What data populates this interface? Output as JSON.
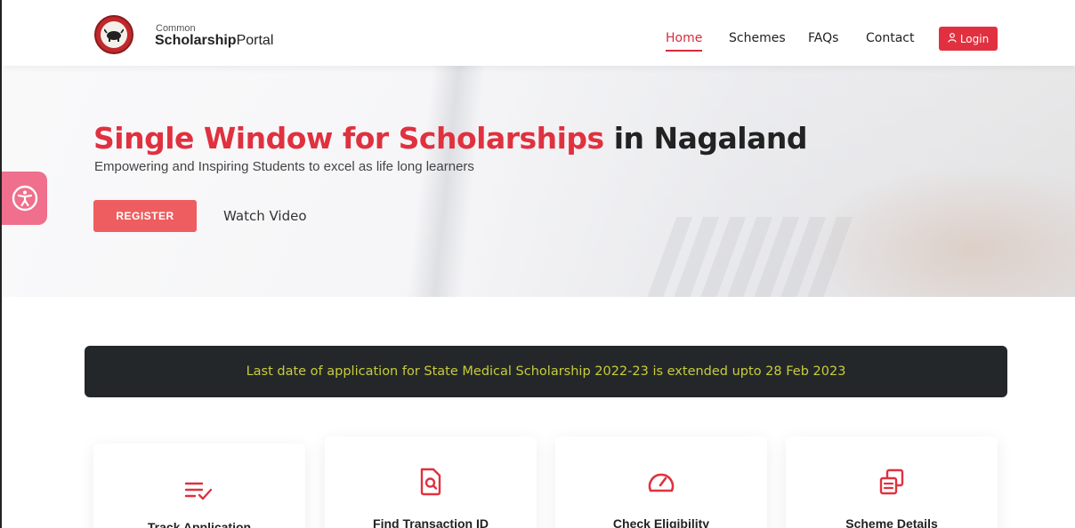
{
  "header": {
    "logo_small": "Common",
    "logo_bold": "Scholarship",
    "logo_rest": "Portal",
    "nav": [
      {
        "label": "Home",
        "active": true
      },
      {
        "label": "Schemes"
      },
      {
        "label": "FAQs"
      },
      {
        "label": "Contact"
      }
    ],
    "login_label": "Login",
    "accent": "#e1303f"
  },
  "hero": {
    "title_red": "Single Window for Scholarships",
    "title_dark": " in Nagaland",
    "subtitle": "Empowering and Inspiring Students to excel as life long learners",
    "register_label": "REGISTER",
    "watch_label": "Watch Video"
  },
  "announcement": {
    "text": "Last date of application for State Medical Scholarship 2022-23 is extended upto 28 Feb 2023",
    "text_color": "#c8cc3a",
    "bg": "#24272a"
  },
  "cards": [
    {
      "label": "Track Application",
      "icon": "list-check-icon"
    },
    {
      "label": "Find Transaction ID",
      "icon": "file-search-icon"
    },
    {
      "label": "Check Eligibility",
      "icon": "speedometer-icon"
    },
    {
      "label": "Scheme Details",
      "icon": "copy-icon"
    }
  ],
  "accessibility": {
    "icon": "accessibility-icon"
  }
}
